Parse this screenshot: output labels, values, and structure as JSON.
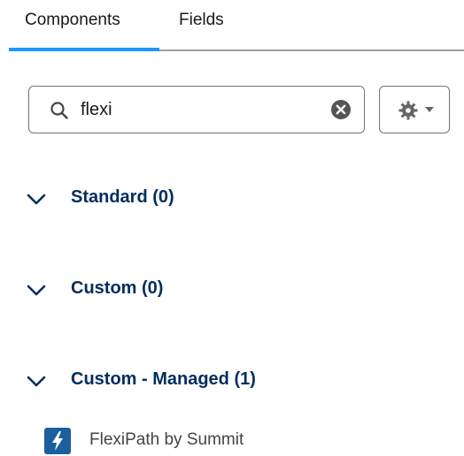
{
  "tabs": [
    {
      "label": "Components",
      "active": true
    },
    {
      "label": "Fields",
      "active": false
    }
  ],
  "search": {
    "value": "flexi",
    "placeholder": "",
    "icon": "search-icon",
    "clear_icon": "clear-icon"
  },
  "settings_button": {
    "icon": "gear-icon",
    "dropdown_icon": "caret-down-icon"
  },
  "sections": [
    {
      "label": "Standard (0)",
      "expanded": true,
      "items": []
    },
    {
      "label": "Custom (0)",
      "expanded": true,
      "items": []
    },
    {
      "label": "Custom - Managed (1)",
      "expanded": true,
      "items": [
        {
          "label": "FlexiPath by Summit",
          "icon": "lightning-bolt-icon"
        }
      ]
    }
  ],
  "colors": {
    "accent": "#1b96ff",
    "section_text": "#032d60",
    "item_icon_bg": "#1b5f9e"
  }
}
